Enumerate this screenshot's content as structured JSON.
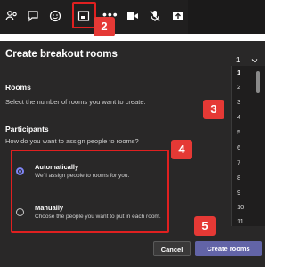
{
  "callouts": {
    "c2": "2",
    "c3": "3",
    "c4": "4",
    "c5": "5"
  },
  "toolbar": {
    "icons": [
      "people-icon",
      "chat-icon",
      "reactions-icon",
      "breakout-rooms-icon",
      "more-icon",
      "camera-icon",
      "mic-off-icon",
      "share-icon"
    ],
    "more_label": "•••"
  },
  "dialog": {
    "title": "Create breakout rooms",
    "rooms_label": "Rooms",
    "rooms_hint": "Select the number of rooms you want to create.",
    "rooms_value": "1",
    "room_options": [
      "1",
      "2",
      "3",
      "4",
      "5",
      "6",
      "7",
      "8",
      "9",
      "10",
      "11"
    ],
    "participants_label": "Participants",
    "participants_hint": "How do you want to assign people to rooms?",
    "automatic_title": "Automatically",
    "automatic_desc": "We'll assign people to rooms for you.",
    "manual_title": "Manually",
    "manual_desc": "Choose the people you want to put in each room.",
    "cancel_label": "Cancel",
    "create_label": "Create rooms"
  },
  "colors": {
    "accent": "#6264a7",
    "callout": "#e53935",
    "dialog_bg": "#292828"
  }
}
